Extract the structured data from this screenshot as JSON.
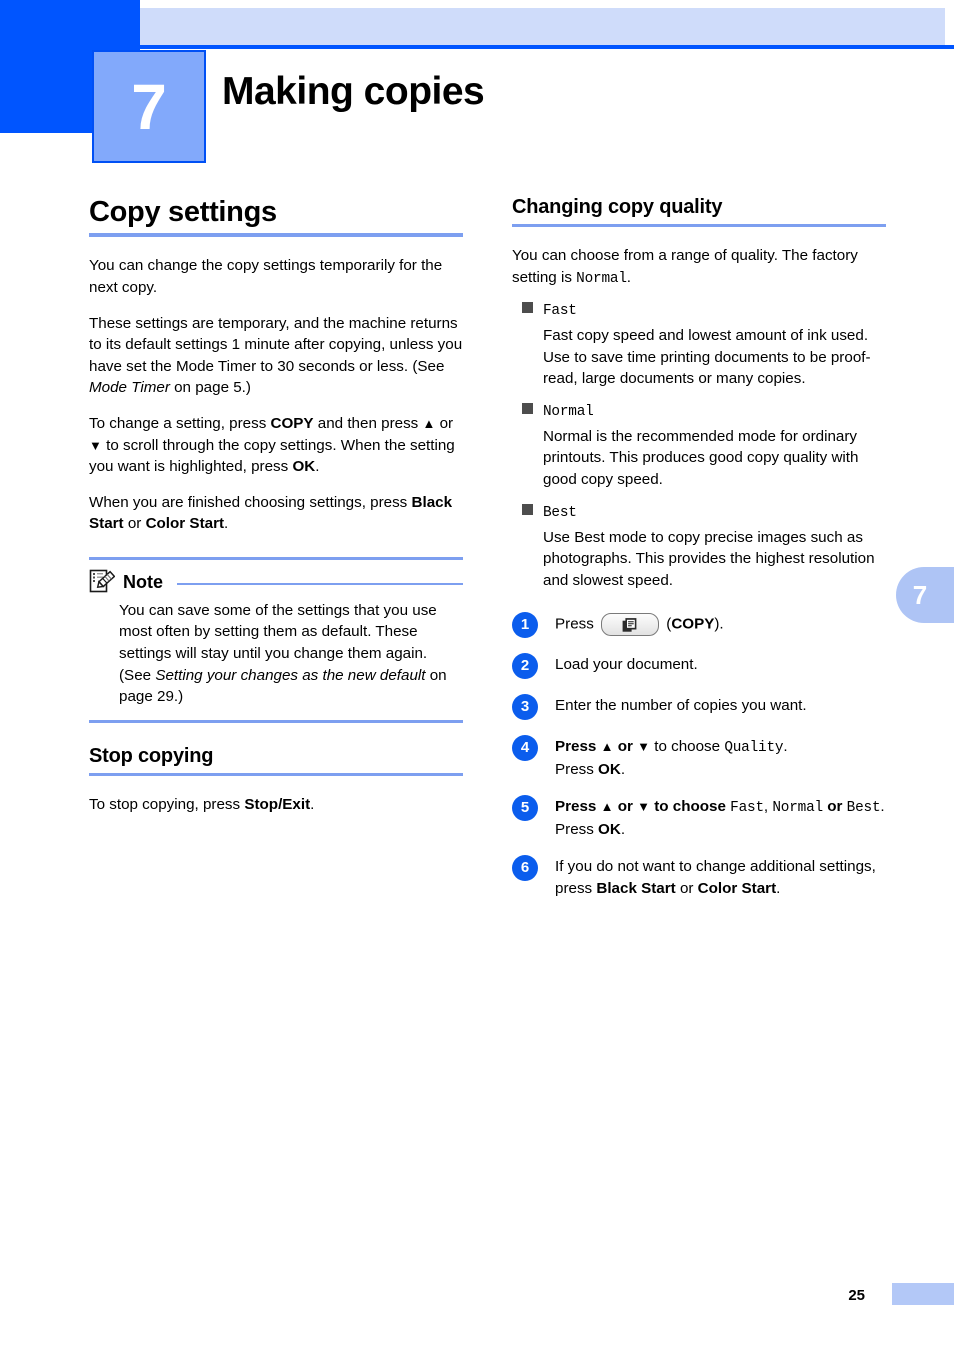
{
  "page": {
    "chapter_number": "7",
    "chapter_title": "Making copies",
    "side_tab_number": "7",
    "page_number": "25"
  },
  "left_column": {
    "heading": "Copy settings",
    "paragraph_1": "You can change the copy settings temporarily for the next copy.",
    "paragraph_2_a": "These settings are temporary, and the machine returns to its default settings 1 minute after copying, unless you have set the Mode Timer to 30 seconds or less. (See ",
    "paragraph_2_italic": "Mode Timer",
    "paragraph_2_b": " on page 5.)",
    "paragraph_3_a": "To change a setting, press ",
    "paragraph_3_copy": "COPY",
    "paragraph_3_b": " and then press ",
    "paragraph_3_up": "▲",
    "paragraph_3_c": " or ",
    "paragraph_3_down": "▼",
    "paragraph_3_d": " to scroll through the copy settings. When the setting you want is highlighted, press ",
    "paragraph_3_ok": "OK",
    "paragraph_3_e": ".",
    "paragraph_4_a": "When you are finished choosing settings, press ",
    "paragraph_4_black": "Black Start",
    "paragraph_4_or": " or ",
    "paragraph_4_color": "Color Start",
    "paragraph_4_end": ".",
    "note": {
      "label": "Note",
      "icon": "note-pencil-icon",
      "text_a": "You can save some of the settings that you use most often by setting them as default. These settings will stay until you change them again. (See ",
      "text_italic": "Setting your changes as the new default",
      "text_b": " on page 29.)"
    },
    "subheading": "Stop copying",
    "stop_text_a": "To stop copying, press ",
    "stop_text_bold": "Stop/Exit",
    "stop_text_b": "."
  },
  "right_column": {
    "heading": "Changing copy quality",
    "intro_a": "You can choose from a range of quality. The factory setting is ",
    "intro_mono": "Normal",
    "intro_b": ".",
    "quality_options": [
      {
        "term": "Fast",
        "description": "Fast copy speed and lowest amount of ink used. Use to save time printing documents to be proof-read, large documents or many copies."
      },
      {
        "term": "Normal",
        "description": "Normal is the recommended mode for ordinary printouts. This produces good copy quality with good copy speed."
      },
      {
        "term": "Best",
        "description": "Use Best mode to copy precise images such as photographs. This provides the highest resolution and slowest speed."
      }
    ],
    "steps": [
      {
        "number": "1",
        "prefix": "Press ",
        "key_icon": "copy-key-icon",
        "suffix_a": " (",
        "suffix_bold": "COPY",
        "suffix_b": ")."
      },
      {
        "number": "2",
        "text": "Load your document."
      },
      {
        "number": "3",
        "text": "Enter the number of copies you want."
      },
      {
        "number": "4",
        "line1_a": "Press ",
        "line1_up": "▲",
        "line1_b": " or ",
        "line1_down": "▼",
        "line1_c": " to choose ",
        "line1_mono": "Quality",
        "line1_d": ".",
        "line2_a": "Press ",
        "line2_bold": "OK",
        "line2_b": "."
      },
      {
        "number": "5",
        "line1_a": "Press ",
        "line1_up": "▲",
        "line1_b": " or ",
        "line1_down": "▼",
        "line1_c": " to choose ",
        "line1_mono1": "Fast",
        "line1_comma": ", ",
        "line1_mono2": "Normal",
        "line1_d": " or ",
        "line1_mono3": "Best",
        "line1_e": ".",
        "line2_a": "Press ",
        "line2_bold": "OK",
        "line2_b": "."
      },
      {
        "number": "6",
        "text_a": "If you do not want to change additional settings, press ",
        "text_bold1": "Black Start",
        "text_or": " or ",
        "text_bold2": "Color Start",
        "text_b": "."
      }
    ]
  },
  "colors": {
    "header_dark_blue": "#0055ff",
    "header_light_band": "#cfdcfa",
    "chapter_square": "#82a9fb",
    "rule_blue": "#7d9ff0",
    "step_badge": "#0b5ded",
    "side_tab": "#aec4f5",
    "footer_bar": "#b3c8f7",
    "bullet_square": "#4d4d4d"
  }
}
